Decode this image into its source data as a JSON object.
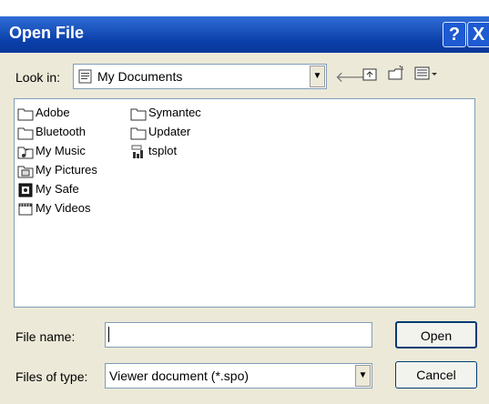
{
  "dialog": {
    "title": "Open File",
    "help_glyph": "?",
    "close_glyph": "X"
  },
  "lookin": {
    "label": "Look in:",
    "value": "My Documents"
  },
  "files": [
    {
      "name": "Adobe",
      "icon": "folder-icon"
    },
    {
      "name": "Bluetooth",
      "icon": "folder-icon"
    },
    {
      "name": "My Music",
      "icon": "music-folder-icon"
    },
    {
      "name": "My Pictures",
      "icon": "pictures-folder-icon"
    },
    {
      "name": "My Safe",
      "icon": "safe-icon"
    },
    {
      "name": "My Videos",
      "icon": "videos-folder-icon"
    },
    {
      "name": "Symantec",
      "icon": "folder-icon"
    },
    {
      "name": "Updater",
      "icon": "folder-icon"
    },
    {
      "name": "tsplot",
      "icon": "spss-file-icon"
    }
  ],
  "filename": {
    "label": "File name:",
    "value": ""
  },
  "filetype": {
    "label": "Files of type:",
    "value": "Viewer document (*.spo)"
  },
  "buttons": {
    "open": "Open",
    "cancel": "Cancel"
  },
  "colors": {
    "titlebar": "#0a3fa8",
    "dialog_bg": "#ece9d8"
  }
}
